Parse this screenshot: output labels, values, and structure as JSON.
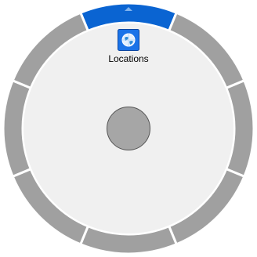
{
  "menu": {
    "items": [
      {
        "label": "Locations",
        "icon": "globe-icon",
        "active": true
      }
    ],
    "segment_count": 8,
    "colors": {
      "active_segment": "#0a64d2",
      "segment": "#a0a0a0",
      "segment_divider": "#ffffff",
      "inner_disc": "#f0f0f0",
      "center_button": "#a6a6a6",
      "icon_background": "#1a73e8"
    }
  }
}
